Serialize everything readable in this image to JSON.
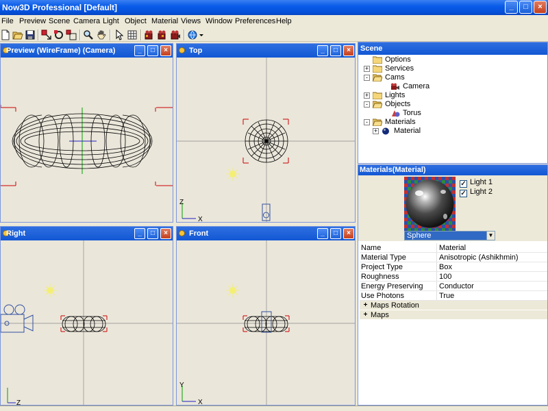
{
  "window": {
    "title": "Now3D Professional [Default]"
  },
  "menu": [
    "File",
    "Preview",
    "Scene",
    "Camera",
    "Light",
    "Object",
    "Material",
    "Views",
    "Window",
    "Preferences",
    "Help"
  ],
  "toolbar": {
    "icons": [
      "new-file-icon",
      "open-folder-icon",
      "save-icon",
      "select-move-icon",
      "rotate-icon",
      "scale-icon",
      "zoom-icon",
      "pan-hand-icon",
      "pointer-icon",
      "grid-icon",
      "render-camera-icon",
      "render-region-icon",
      "render-final-icon",
      "web-export-icon",
      "dropdown-arrow-icon"
    ]
  },
  "viewports": {
    "preview": {
      "title": "Preview (WireFrame) (Camera)"
    },
    "top": {
      "title": "Top",
      "axis_v": "Z",
      "axis_h": "X"
    },
    "right": {
      "title": "Right",
      "axis_h": "Z"
    },
    "front": {
      "title": "Front",
      "axis_v": "Y",
      "axis_h": "X"
    }
  },
  "scene": {
    "title": "Scene",
    "tree": [
      {
        "label": "Options",
        "level": 0,
        "expander": "",
        "icon": "folder-icon"
      },
      {
        "label": "Services",
        "level": 0,
        "expander": "+",
        "icon": "folder-icon"
      },
      {
        "label": "Cams",
        "level": 0,
        "expander": "-",
        "icon": "folder-open-icon"
      },
      {
        "label": "Camera",
        "level": 1,
        "expander": "",
        "icon": "camera-icon"
      },
      {
        "label": "Lights",
        "level": 0,
        "expander": "+",
        "icon": "folder-icon"
      },
      {
        "label": "Objects",
        "level": 0,
        "expander": "-",
        "icon": "folder-open-icon"
      },
      {
        "label": "Torus",
        "level": 1,
        "expander": "",
        "icon": "object-icon"
      },
      {
        "label": "Materials",
        "level": 0,
        "expander": "-",
        "icon": "folder-open-icon"
      },
      {
        "label": "Material",
        "level": 1,
        "expander": "+",
        "icon": "material-sphere-icon"
      }
    ]
  },
  "materials": {
    "title": "Materials(Material)",
    "lights": [
      {
        "label": "Light 1",
        "checked": true
      },
      {
        "label": "Light 2",
        "checked": true
      }
    ],
    "preview_shape": "Sphere",
    "properties": [
      {
        "name": "Name",
        "value": "Material"
      },
      {
        "name": "Material Type",
        "value": "Anisotropic (Ashikhmin)"
      },
      {
        "name": "Project Type",
        "value": "Box"
      },
      {
        "name": "Roughness",
        "value": "100"
      },
      {
        "name": "Energy Preserving",
        "value": "Conductor"
      },
      {
        "name": "Use Photons",
        "value": "True"
      }
    ],
    "groups": [
      "Maps Rotation",
      "Maps"
    ]
  },
  "colors": {
    "title_blue": "#0A5CE8",
    "pane_bg": "#EAE6DA",
    "wire": "#000000",
    "bbox": "#CC0000",
    "axis_green": "#00A000",
    "axis_blue": "#2020C0",
    "light_yellow": "#F5F06A"
  }
}
